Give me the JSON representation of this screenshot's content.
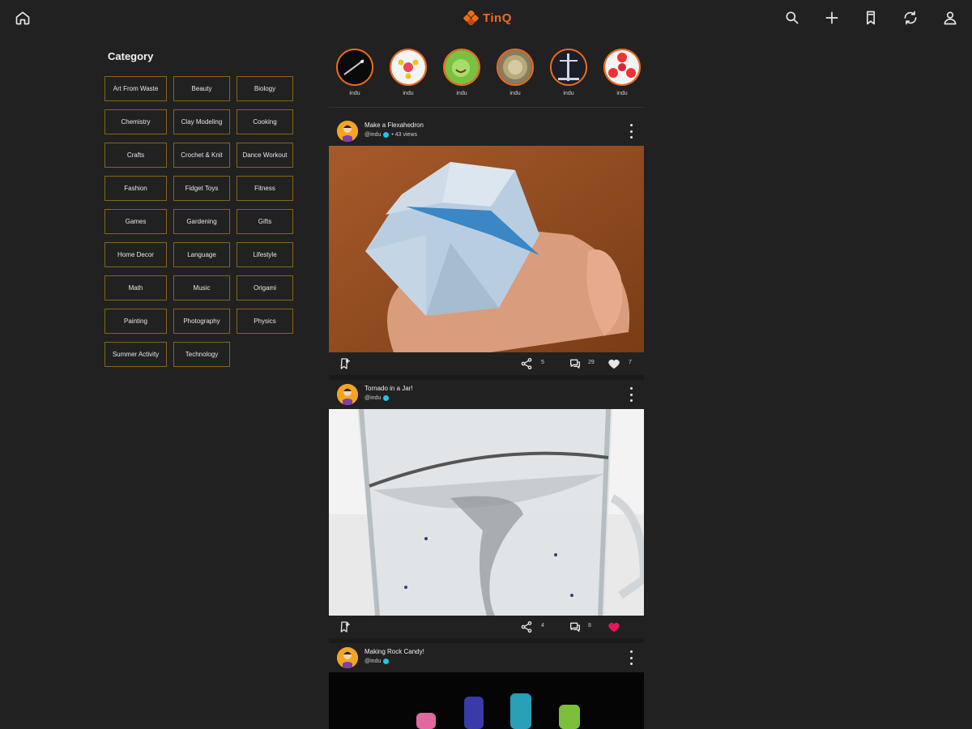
{
  "brand": {
    "name": "TinQ",
    "accent": "#f26a1b"
  },
  "topbar": {
    "icons": [
      "home-icon",
      "search-icon",
      "add-icon",
      "bookmark-icon",
      "refresh-icon",
      "user-icon"
    ]
  },
  "sidebar": {
    "title": "Category",
    "categories": [
      "Art From Waste",
      "Beauty",
      "Biology",
      "Chemistry",
      "Clay Modeling",
      "Cooking",
      "Crafts",
      "Crochet & Knit",
      "Dance Workout",
      "Fashion",
      "Fidget Toys",
      "Fitness",
      "Games",
      "Gardening",
      "Gifts",
      "Home Decor",
      "Language",
      "Lifestyle",
      "Math",
      "Music",
      "Origami",
      "Painting",
      "Photography",
      "Physics",
      "Summer Activity",
      "Technology"
    ]
  },
  "stories": [
    {
      "label": "indu"
    },
    {
      "label": "indu"
    },
    {
      "label": "indu"
    },
    {
      "label": "indu"
    },
    {
      "label": "indu"
    },
    {
      "label": "indu"
    }
  ],
  "posts": [
    {
      "title": "Make a Flexahedron",
      "handle": "@indu",
      "views": "• 43 views",
      "shares": "5",
      "comments": "29",
      "likes": "7",
      "liked": false
    },
    {
      "title": "Tornado in a Jar!",
      "handle": "@indu",
      "views": "",
      "shares": "4",
      "comments": "8",
      "likes": "",
      "liked": true
    },
    {
      "title": "Making Rock Candy!",
      "handle": "@indu",
      "views": "",
      "shares": "",
      "comments": "",
      "likes": "",
      "liked": false
    }
  ],
  "colors": {
    "background": "#212121",
    "border": "#8a6416",
    "like": "#e8175d",
    "verified": "#1ec8e6"
  }
}
